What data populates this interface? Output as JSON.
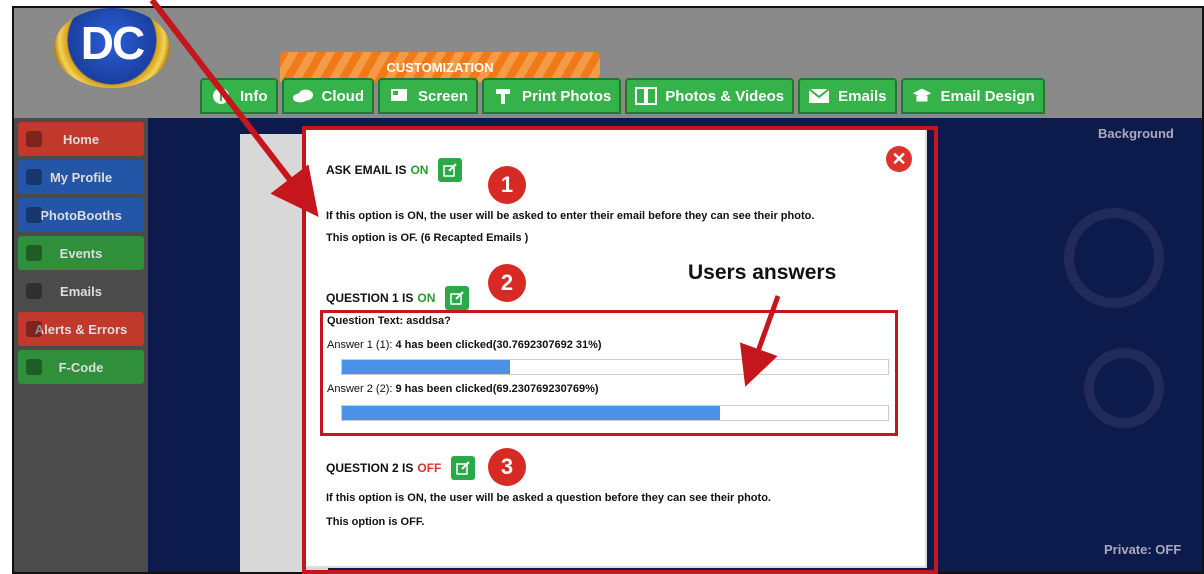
{
  "app": {
    "logo_text": "DC",
    "customization_label": "CUSTOMIZATION"
  },
  "tabs": [
    {
      "label": "Info",
      "icon": "info-icon"
    },
    {
      "label": "Cloud",
      "icon": "cloud-icon"
    },
    {
      "label": "Screen",
      "icon": "screen-icon"
    },
    {
      "label": "Print Photos",
      "icon": "print-icon"
    },
    {
      "label": "Photos & Videos",
      "icon": "photos-icon"
    },
    {
      "label": "Emails",
      "icon": "envelope-icon"
    },
    {
      "label": "Email Design",
      "icon": "email-design-icon"
    }
  ],
  "sidebar": {
    "items": [
      {
        "label": "Home",
        "color": "#c0392b"
      },
      {
        "label": "My Profile",
        "color": "#2456a8"
      },
      {
        "label": "PhotoBooths",
        "color": "#2456a8"
      },
      {
        "label": "Events",
        "color": "#2f8f3a"
      },
      {
        "label": "Emails",
        "color": "#4b4b4b"
      },
      {
        "label": "Alerts & Errors",
        "color": "#c0392b"
      },
      {
        "label": "F-Code",
        "color": "#2f8f3a"
      }
    ]
  },
  "background": {
    "background_button": "Background",
    "private_off_button": "Private: OFF"
  },
  "modal": {
    "ask_email": {
      "prefix": "ASK EMAIL IS",
      "state": "ON",
      "desc": "If this option is ON, the user will be asked to enter their email before they can see their photo.",
      "status": "This option is OF. (6 Recapted Emails )"
    },
    "question1": {
      "prefix": "QUESTION 1 IS",
      "state": "ON",
      "question_text": "Question Text: asddsa?",
      "answers": [
        {
          "label": "Answer 1 (1):",
          "result": "4 has been clicked(30.7692307692 31%)",
          "percent": 30.7692307692
        },
        {
          "label": "Answer 2 (2):",
          "result": "9 has been clicked(69.230769230769%)",
          "percent": 69.230769230769
        }
      ]
    },
    "question2": {
      "prefix": "QUESTION 2 IS",
      "state": "OFF",
      "desc": "If this option is ON, the user will be asked a question before they can see their photo.",
      "status": "This option is OFF."
    }
  },
  "annotations": {
    "badges": [
      "1",
      "2",
      "3"
    ],
    "users_answers_label": "Users answers",
    "color_red": "#c4161c"
  }
}
